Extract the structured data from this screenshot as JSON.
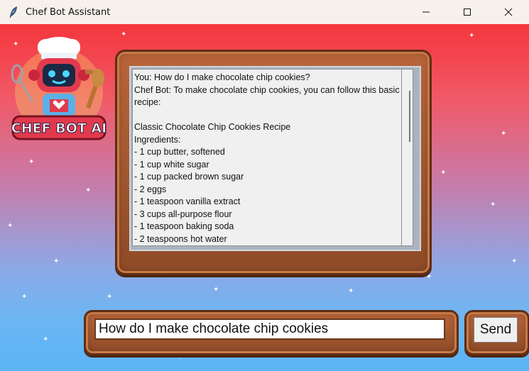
{
  "window": {
    "title": "Chef Bot Assistant",
    "controls": [
      "minimize",
      "maximize",
      "close"
    ]
  },
  "logo": {
    "text": "CHEF BOT AI"
  },
  "chat": {
    "lines": [
      "You: How do I make chocolate chip cookies?",
      "Chef Bot: To make chocolate chip cookies, you can follow this basic recipe:",
      "",
      "Classic Chocolate Chip Cookies Recipe",
      "Ingredients:",
      "- 1 cup butter, softened",
      "- 1 cup white sugar",
      "- 1 cup packed brown sugar",
      "- 2 eggs",
      "- 1 teaspoon vanilla extract",
      "- 3 cups all-purpose flour",
      "- 1 teaspoon baking soda",
      "- 2 teaspoons hot water"
    ]
  },
  "input": {
    "value": "How do I make chocolate chip cookies"
  },
  "send": {
    "label": "Send"
  },
  "colors": {
    "bg_top": "#f5363d",
    "bg_bottom": "#5cb4f5",
    "wood": "#a55a31",
    "wood_dark": "#5e2d14"
  }
}
